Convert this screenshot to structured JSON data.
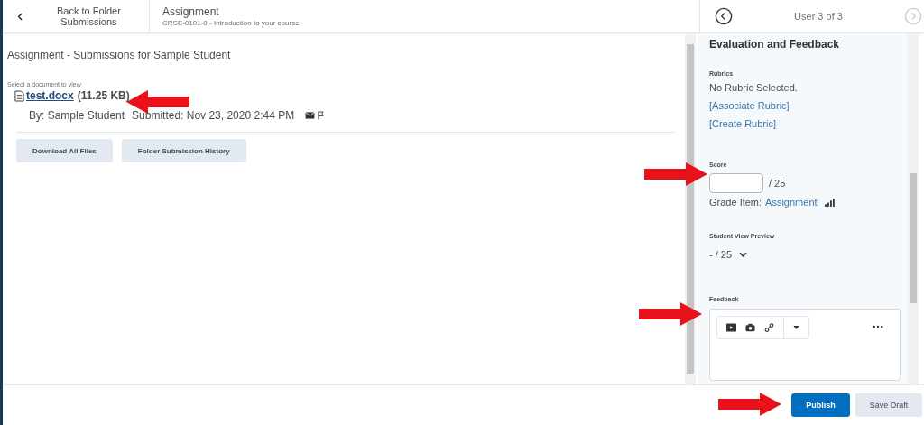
{
  "header": {
    "back_link": "Back to Folder Submissions",
    "title": "Assignment",
    "subtitle": "CRSE-0101-0 - Introduction to your course",
    "user_nav": "User 3 of 3",
    "nav_buttons": [
      {
        "kind": "prev",
        "disabled": false
      },
      {
        "kind": "next",
        "disabled": true
      }
    ]
  },
  "submissions": {
    "heading": "Assignment - Submissions for Sample Student",
    "select_label": "Select a document to view",
    "file": {
      "name": "test.docx",
      "size": "(11.25 KB)"
    },
    "by": "By: Sample Student",
    "submitted": "Submitted: Nov 23, 2020 2:44 PM",
    "buttons": [
      "Download All Files",
      "Folder Submission History"
    ]
  },
  "evaluation": {
    "heading": "Evaluation and Feedback",
    "rubrics": {
      "label": "Rubrics",
      "status": "No Rubric Selected.",
      "links": [
        "[Associate Rubric]",
        "[Create Rubric]"
      ]
    },
    "score": {
      "label": "Score",
      "out_of": "/ 25",
      "grade_item_label": "Grade Item:",
      "grade_item": "Assignment"
    },
    "preview": {
      "label": "Student View Preview",
      "value": "- / 25"
    },
    "feedback": {
      "label": "Feedback"
    }
  },
  "footer": {
    "buttons": [
      {
        "label": "Publish",
        "kind": "primary"
      },
      {
        "label": "Save Draft",
        "kind": "secondary"
      }
    ]
  }
}
